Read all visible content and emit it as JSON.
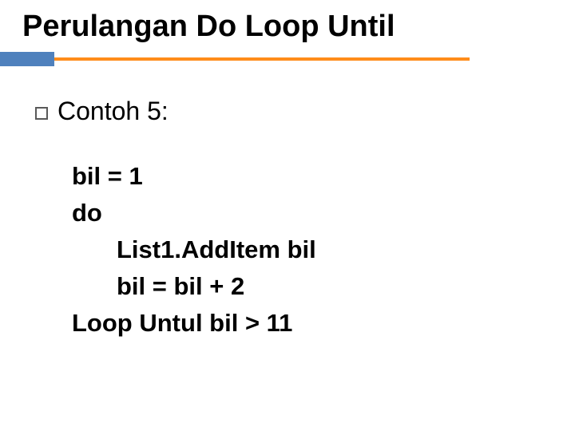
{
  "title": "Perulangan Do Loop Until",
  "subtitle": "Contoh 5:",
  "code": {
    "line1": "bil = 1",
    "line2": "do",
    "line3": "List1.AddItem bil",
    "line4": "bil = bil + 2",
    "line5": "Loop Untul bil > 11"
  }
}
